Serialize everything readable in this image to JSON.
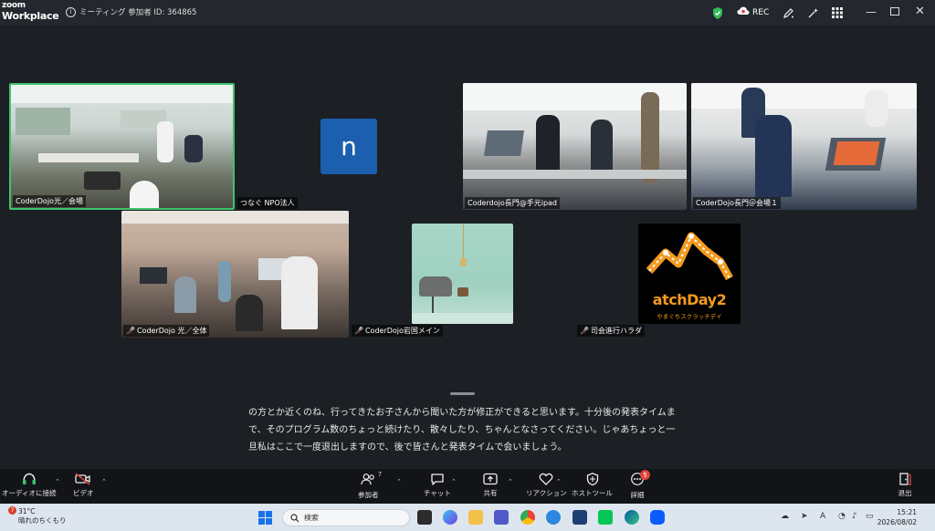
{
  "titlebar": {
    "brand_line1": "zoom",
    "brand_line2": "Workplace",
    "meeting_info": "ミーティング 参加者 ID: 364865",
    "rec_label": "REC"
  },
  "participants": {
    "tile1_label": "CoderDojo光／会場",
    "avatar_letter": "n",
    "npo_label": "つなぐ NPO法人",
    "tile2_label": "Coderdojo長門@手元ipad",
    "tile3_label": "CoderDojo長門＠会場１",
    "tile4_label": "CoderDojo 光／全体",
    "tile5_label": "CoderDojo岩国メイン",
    "tile6_label": "司会進行ハラダ",
    "logo_text": "atchDay2",
    "logo_sub": "やまぐちスクラッチデイ"
  },
  "caption": {
    "text": "の方とか近くのね、行ってきたお子さんから聞いた方が修正ができると思います。十分後の発表タイムまで、そのプログラム数のちょっと続けたり、散々したり、ちゃんとなさってください。じゃあちょっと一旦私はここで一度退出しますので、後で皆さんと発表タイムで会いましょう。"
  },
  "toolbar": {
    "audio_label": "オーディオに接続",
    "video_label": "ビデオ",
    "participants_label": "参加者",
    "participants_count": "7",
    "chat_label": "チャット",
    "share_label": "共有",
    "reactions_label": "リアクション",
    "host_tools_label": "ホストツール",
    "more_label": "詳細",
    "more_badge": "5",
    "leave_label": "退出"
  },
  "taskbar": {
    "weather_temp": "31°C",
    "weather_desc": "晴れのちくもり",
    "weather_badge": "7",
    "search_placeholder": "検索",
    "time": "15:21",
    "date": "2026/08/02"
  },
  "colors": {
    "active_speaker_border": "#3ec46d",
    "avatar_bg": "#1b5fae",
    "alert_red": "#e0433b"
  }
}
